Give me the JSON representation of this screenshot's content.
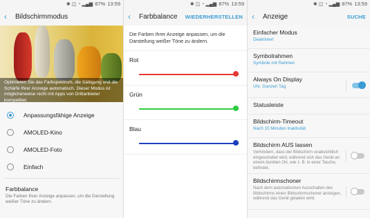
{
  "status": {
    "icons": "✱ ◫ ◔ ▂▄▆",
    "battery": "87%",
    "time": "13:59"
  },
  "panel1": {
    "title": "Bildschirmmodus",
    "hero_text": "Optimieren Sie das Farbspektrum, die Sättigung und die Schärfe Ihrer Anzeige automatisch. Dieser Modus ist möglicherweise nicht mit Apps von Drittanbieter kompatibel.",
    "options": [
      "Anpassungsfähige Anzeige",
      "AMOLED-Kino",
      "AMOLED-Foto",
      "Einfach"
    ],
    "selected": "Anpassungsfähige Anzeige",
    "farbbalance_title": "Farbbalance",
    "farbbalance_desc": "Die Farben Ihrer Anzeige anpassen, um die Darstellung weißer Töne zu ändern."
  },
  "panel2": {
    "title": "Farbbalance",
    "action": "WIEDERHERSTELLEN",
    "desc": "Die Farben Ihrer Anzeige anpassen, um die Darstellung weißer Töne zu ändern.",
    "sliders": [
      {
        "label": "Rot",
        "color": "#e53935",
        "value": 1.0
      },
      {
        "label": "Grün",
        "color": "#2ecc40",
        "value": 1.0
      },
      {
        "label": "Blau",
        "color": "#1f3fbf",
        "value": 1.0
      }
    ]
  },
  "panel3": {
    "title": "Anzeige",
    "action": "SUCHE",
    "rows": [
      {
        "title": "Einfacher Modus",
        "sub": "Deaktiviert"
      },
      {
        "title": "Symbolrahmen",
        "sub": "Symbole mit Rahmen"
      },
      {
        "title": "Always On Display",
        "sub": "Uhr, Ganzen Tag",
        "toggle": "on"
      },
      {
        "title": "Statusleiste"
      },
      {
        "title": "Bildschirm-Timeout",
        "sub": "Nach 10 Minuten Inaktivität"
      },
      {
        "title": "Bildschirm AUS lassen",
        "desc": "Verhindern, dass der Bildschirm unabsichtlich eingeschaltet wird, während sich das Gerät an einem dunklen Ort, wie z. B. in einer Tasche, befindet.",
        "toggle": "off"
      },
      {
        "title": "Bildschirmschoner",
        "desc": "Nach dem automatischen Ausschalten des Bildschirms einen Bildschirmschoner anzeigen, während das Gerät geladen wird.",
        "toggle": "off"
      }
    ]
  },
  "colors": {
    "accent": "#3b9bd4"
  }
}
